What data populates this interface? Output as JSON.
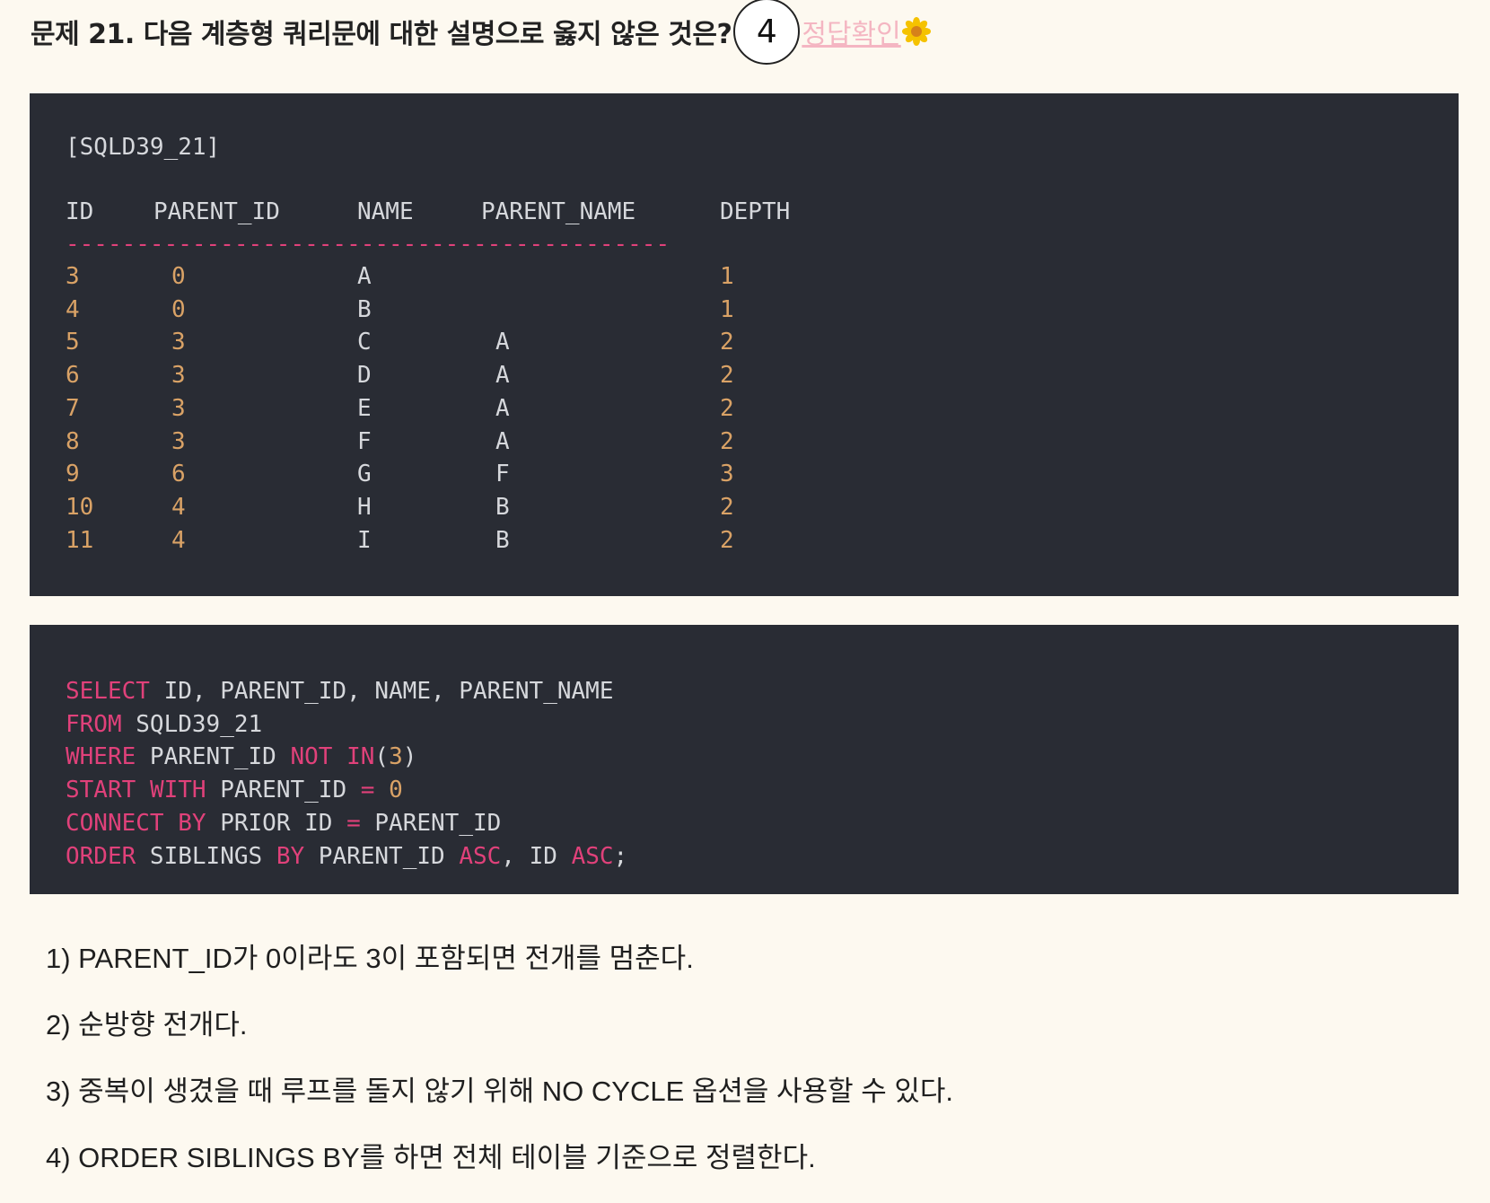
{
  "question": {
    "title": "문제 21. 다음 계층형 쿼리문에 대한 설명으로 옳지 않은 것은?",
    "answer": "4",
    "check_label": "정답확인",
    "check_icon": "flower-icon"
  },
  "table_block": {
    "table_name": "[SQLD39_21]",
    "headers": [
      "ID",
      "PARENT_ID",
      "NAME",
      "PARENT_NAME",
      "DEPTH"
    ],
    "separator": "-------------------------------------------",
    "rows": [
      [
        "3",
        "0",
        "A",
        "",
        "1"
      ],
      [
        "4",
        "0",
        "B",
        "",
        "1"
      ],
      [
        "5",
        "3",
        "C",
        "A",
        "2"
      ],
      [
        "6",
        "3",
        "D",
        "A",
        "2"
      ],
      [
        "7",
        "3",
        "E",
        "A",
        "2"
      ],
      [
        "8",
        "3",
        "F",
        "A",
        "2"
      ],
      [
        "9",
        "6",
        "G",
        "F",
        "3"
      ],
      [
        "10",
        "4",
        "H",
        "B",
        "2"
      ],
      [
        "11",
        "4",
        "I",
        "B",
        "2"
      ]
    ]
  },
  "sql_block": {
    "lines": [
      [
        {
          "t": "SELECT",
          "k": 1
        },
        {
          "t": " ID, PARENT_ID, NAME, PARENT_NAME",
          "k": 0
        }
      ],
      [
        {
          "t": "FROM",
          "k": 1
        },
        {
          "t": " SQLD39_21",
          "k": 0
        }
      ],
      [
        {
          "t": "WHERE",
          "k": 1
        },
        {
          "t": " PARENT_ID ",
          "k": 0
        },
        {
          "t": "NOT",
          "k": 1
        },
        {
          "t": " ",
          "k": 0
        },
        {
          "t": "IN",
          "k": 1
        },
        {
          "t": "(",
          "k": 0
        },
        {
          "t": "3",
          "k": 2
        },
        {
          "t": ")",
          "k": 0
        }
      ],
      [
        {
          "t": "START",
          "k": 1
        },
        {
          "t": " ",
          "k": 0
        },
        {
          "t": "WITH",
          "k": 1
        },
        {
          "t": " PARENT_ID ",
          "k": 0
        },
        {
          "t": "=",
          "k": 1
        },
        {
          "t": " ",
          "k": 0
        },
        {
          "t": "0",
          "k": 2
        }
      ],
      [
        {
          "t": "CONNECT",
          "k": 1
        },
        {
          "t": " ",
          "k": 0
        },
        {
          "t": "BY",
          "k": 1
        },
        {
          "t": " PRIOR ID ",
          "k": 0
        },
        {
          "t": "=",
          "k": 1
        },
        {
          "t": " PARENT_ID",
          "k": 0
        }
      ],
      [
        {
          "t": "ORDER",
          "k": 1
        },
        {
          "t": " SIBLINGS ",
          "k": 0
        },
        {
          "t": "BY",
          "k": 1
        },
        {
          "t": " PARENT_ID ",
          "k": 0
        },
        {
          "t": "ASC",
          "k": 1
        },
        {
          "t": ", ID ",
          "k": 0
        },
        {
          "t": "ASC",
          "k": 1
        },
        {
          "t": ";",
          "k": 0
        }
      ]
    ]
  },
  "options": [
    "1) PARENT_ID가 0이라도 3이 포함되면 전개를 멈춘다.",
    "2) 순방향 전개다.",
    "3) 중복이 생겼을 때 루프를 돌지 않기 위해 NO CYCLE 옵션을 사용할 수 있다.",
    "4) ORDER SIBLINGS BY를 하면 전체 테이블 기준으로 정렬한다."
  ]
}
